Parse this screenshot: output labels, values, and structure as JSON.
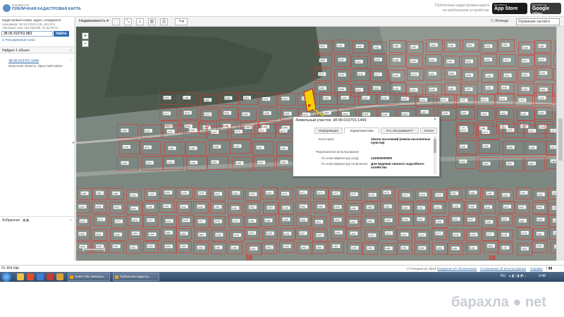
{
  "header": {
    "brand_top": "РОСРЕЕСТР",
    "brand_main": "ПУБЛИЧНАЯ КАДАСТРОВАЯ КАРТА",
    "promo": [
      "Публичная кадастровая карта",
      "на мобильном устройстве"
    ],
    "appstore": {
      "small": "Доступно в",
      "big": "App Store"
    },
    "googleplay": {
      "small": "Доступно на",
      "big": "Google play"
    }
  },
  "search": {
    "hint": "Кадастровый номер, адрес, координата",
    "hint_example1": "Например: 48:15:10104:12к, к61:67к",
    "hint_example2": "«Москва» или «55.755768, 37.617671»",
    "value": "38 06 010701 883",
    "find_label": "Найти",
    "extended_label": "▸ Расширенный поиск"
  },
  "results": {
    "found_label": "Найден 1 объект",
    "item_link": "38:06:010701:1449",
    "item_address": "Иркутская область, Иркутский район"
  },
  "favorites": {
    "label": "Избранное"
  },
  "toolbar": {
    "layer_label": "Недвижимость ▾",
    "tools": [
      "rectangle-select",
      "measure",
      "filter",
      "chart",
      "print",
      "pen"
    ],
    "legend_label": "Легенда",
    "basemap_label": "Угрожение сагтой ▾"
  },
  "map": {
    "quarter_labels": [
      "38",
      "38"
    ],
    "scale_label": "",
    "parcel_labels": [
      "1441",
      "1442",
      "1446",
      "1461",
      "1450",
      "1452",
      "1453",
      "1438",
      "1460",
      "1462",
      "1464",
      "1466",
      "1480",
      "1482",
      "1484",
      "1432",
      "1433",
      "1434",
      "1435",
      "1436",
      "1437",
      "1440",
      "1443",
      "1444",
      "1470",
      "1471",
      "1472",
      "1473",
      "1474",
      "1475",
      "1476",
      "1477",
      "1478",
      "1479",
      "1481",
      "1483",
      "1485",
      "1490",
      "1491",
      "1492",
      "1493",
      "1494",
      "1495",
      "1496",
      "1497",
      "1498"
    ]
  },
  "popup": {
    "title": "Земельный участок: 38:06:010701:1449",
    "tabs": [
      "Информация",
      "Характеристики",
      "Кто обслуживает?",
      "Услуги"
    ],
    "active_tab": "Характеристики",
    "rows": [
      {
        "label": "Категория:",
        "value": "Земли поселений (земли населенных пунктов)"
      },
      {
        "label": "Разрешенное использование",
        "value": ""
      },
      {
        "label": "По классификатору (код):",
        "value": "141003000000"
      },
      {
        "label": "По классификатору (описание):",
        "value": "Для ведения личного подсобного хозяйства"
      }
    ]
  },
  "statusbar": {
    "coords": "01 454 http",
    "copyright": "| © Росреестр, 2013 |",
    "links": [
      "Сведения об обновлениях",
      "Соглашение об использовании",
      "Справка"
    ],
    "flag": "| ▮▮"
  },
  "taskbar": {
    "windows": [
      "H190 Fully Waterpro...",
      "Публичная кадастр..."
    ],
    "lang": "RU",
    "clock": "0:48"
  },
  "watermark": "барахла ● net",
  "colors": {
    "parcel_outline": "#e0312d",
    "highlight": "#f5d000",
    "brand": "#2d6aa5"
  }
}
